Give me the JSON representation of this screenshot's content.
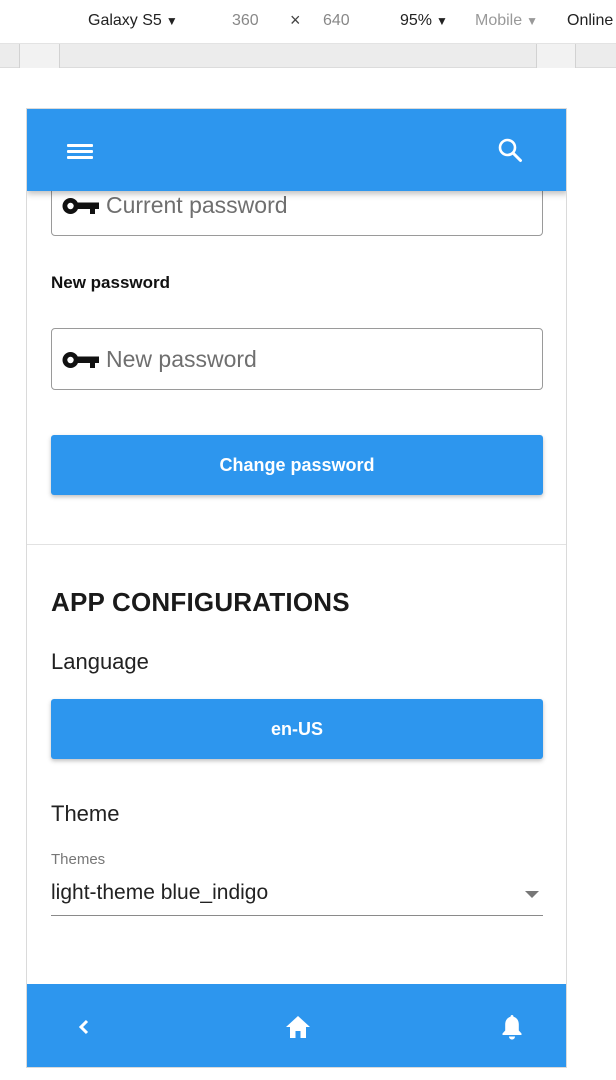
{
  "devtools": {
    "device": "Galaxy S5",
    "width": "360",
    "times": "×",
    "height": "640",
    "zoom": "95%",
    "throttle": "Mobile",
    "network": "Online"
  },
  "password_form": {
    "current_placeholder": "Current password",
    "new_label": "New password",
    "new_placeholder": "New password",
    "change_button": "Change password"
  },
  "app_config": {
    "title": "APP CONFIGURATIONS",
    "language_label": "Language",
    "language_value": "en-US",
    "theme_label": "Theme",
    "themes_float_label": "Themes",
    "theme_value": "light-theme blue_indigo"
  },
  "icons": {
    "header_left": "menu-icon",
    "header_right": "search-icon",
    "field": "key-icon",
    "nav_back": "chevron-left-icon",
    "nav_home": "home-icon",
    "nav_bell": "bell-icon"
  },
  "colors": {
    "primary": "#2d96ee",
    "on_primary": "#ffffff"
  }
}
